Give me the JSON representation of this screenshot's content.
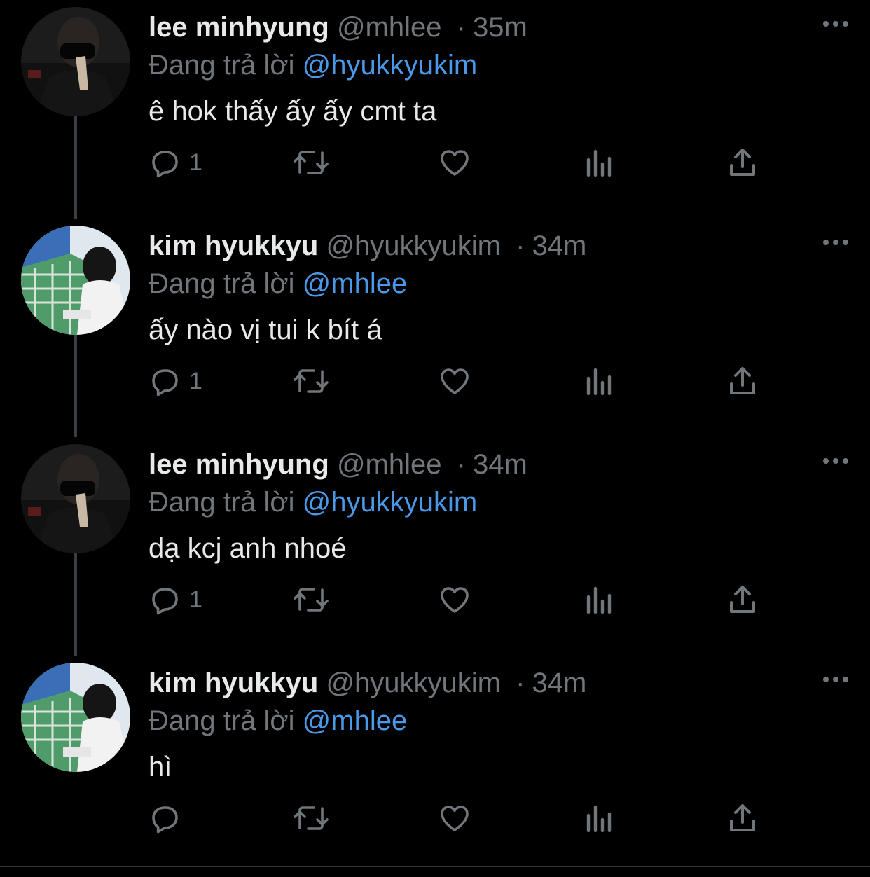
{
  "thread": [
    {
      "name": "lee minhyung",
      "handle": "@mhlee",
      "separator": "·",
      "time": "35m",
      "reply_prefix": "Đang trả lời",
      "reply_to": "@hyukkyukim",
      "text": "ê hok thấy ấy ấy cmt ta",
      "reply_count": "1",
      "avatar": "avatar-lee-minhyung"
    },
    {
      "name": "kim hyukkyu",
      "handle": "@hyukkyukim",
      "separator": "·",
      "time": "34m",
      "reply_prefix": "Đang trả lời",
      "reply_to": "@mhlee",
      "text": "ấy nào vị tui k bít á",
      "reply_count": "1",
      "avatar": "avatar-kim-hyukkyu"
    },
    {
      "name": "lee minhyung",
      "handle": "@mhlee",
      "separator": "·",
      "time": "34m",
      "reply_prefix": "Đang trả lời",
      "reply_to": "@hyukkyukim",
      "text": "dạ kcj anh nhoé",
      "reply_count": "1",
      "avatar": "avatar-lee-minhyung"
    },
    {
      "name": "kim hyukkyu",
      "handle": "@hyukkyukim",
      "separator": "·",
      "time": "34m",
      "reply_prefix": "Đang trả lời",
      "reply_to": "@mhlee",
      "text": "hì",
      "reply_count": "",
      "avatar": "avatar-kim-hyukkyu"
    }
  ],
  "icons": {
    "reply": "reply-icon",
    "retweet": "retweet-icon",
    "like": "heart-icon",
    "views": "views-icon",
    "share": "share-icon",
    "more": "more-icon"
  },
  "colors": {
    "background": "#000000",
    "text": "#e7e9ea",
    "secondary": "#71767b",
    "mention": "#4a99e9",
    "thread_line": "#3a3d41"
  }
}
